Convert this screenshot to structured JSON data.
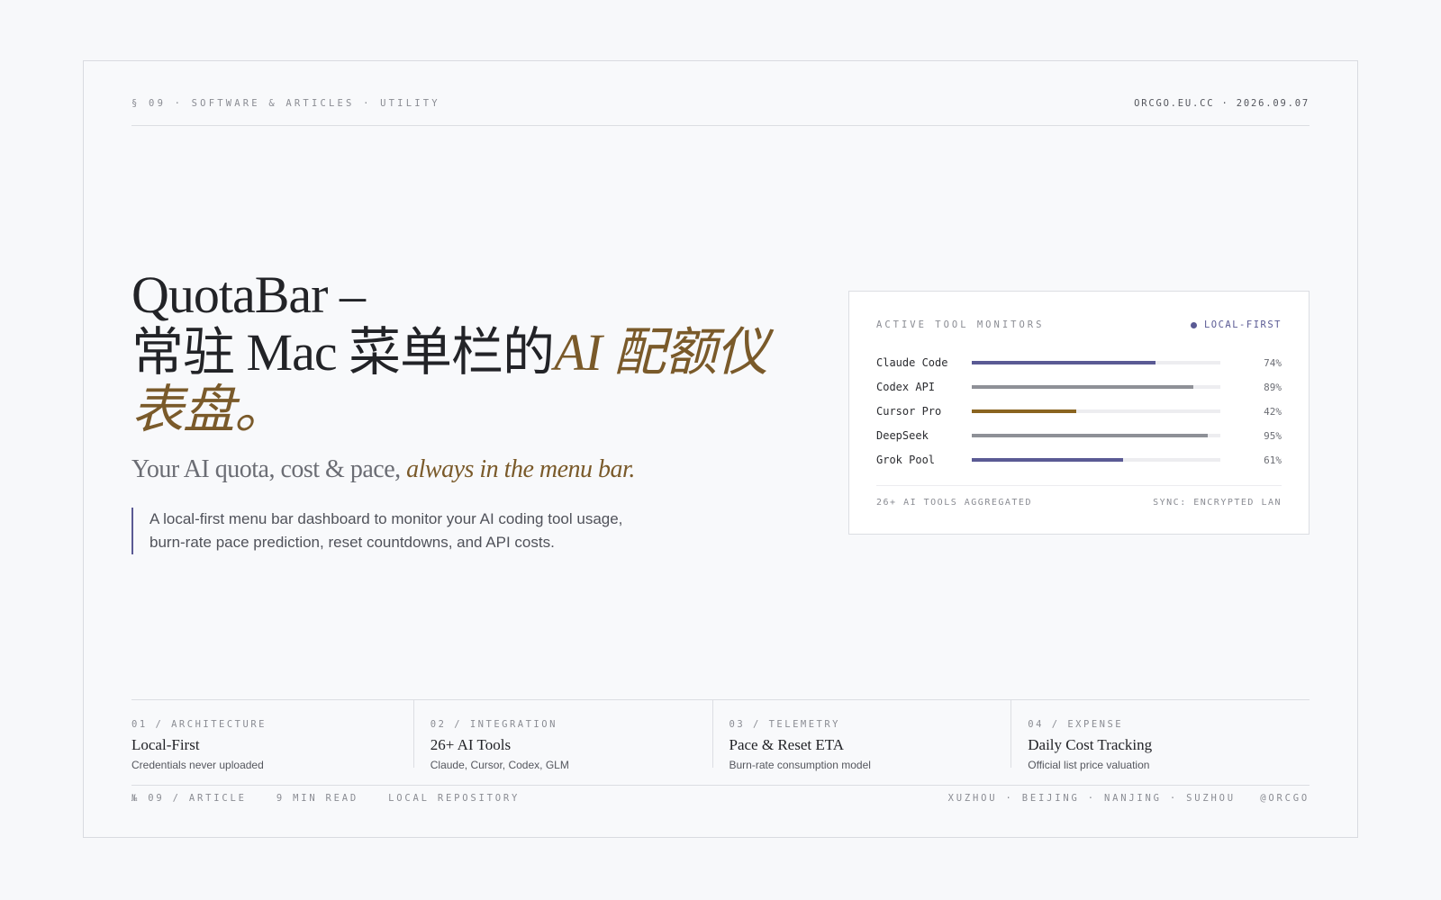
{
  "header": {
    "left": "§ 09 · SOFTWARE & ARTICLES · UTILITY",
    "right": "ORCGO.EU.CC · 2026.09.07"
  },
  "hero": {
    "title_line1": "QuotaBar –",
    "title_line2_plain": "常驻 Mac 菜单栏的",
    "title_line2_accent": "AI 配额仪",
    "title_line3_accent": "表盘。",
    "subtitle_plain": "Your AI quota, cost & pace, ",
    "subtitle_accent": "always in the menu bar.",
    "description": "A local-first menu bar dashboard to monitor your AI coding tool usage, burn-rate pace prediction, reset countdowns, and API costs."
  },
  "panel": {
    "title": "ACTIVE TOOL MONITORS",
    "badge": "LOCAL-FIRST",
    "monitors": [
      {
        "name": "Claude Code",
        "percent_label": "74%",
        "level": 0.74,
        "color": "#5a5a94"
      },
      {
        "name": "Codex API",
        "percent_label": "89%",
        "level": 0.89,
        "color": "#8e9097"
      },
      {
        "name": "Cursor Pro",
        "percent_label": "42%",
        "level": 0.42,
        "color": "#8a6420"
      },
      {
        "name": "DeepSeek",
        "percent_label": "95%",
        "level": 0.95,
        "color": "#8e9097"
      },
      {
        "name": "Grok Pool",
        "percent_label": "61%",
        "level": 0.61,
        "color": "#5a5a94"
      }
    ],
    "footer_left": "26+ AI TOOLS AGGREGATED",
    "footer_right": "SYNC: ENCRYPTED LAN"
  },
  "features": [
    {
      "kicker": "01 / ARCHITECTURE",
      "title": "Local-First",
      "sub": "Credentials never uploaded"
    },
    {
      "kicker": "02 / INTEGRATION",
      "title": "26+ AI Tools",
      "sub": "Claude, Cursor, Codex, GLM"
    },
    {
      "kicker": "03 / TELEMETRY",
      "title": "Pace & Reset ETA",
      "sub": "Burn-rate consumption model"
    },
    {
      "kicker": "04 / EXPENSE",
      "title": "Daily Cost Tracking",
      "sub": "Official list price valuation"
    }
  ],
  "footer": {
    "article": "№ 09 / ARTICLE",
    "read_time": "9 MIN READ",
    "repo": "LOCAL REPOSITORY",
    "right": "XUZHOU · BEIJING · NANJING · SUZHOU   @ORCGO"
  }
}
